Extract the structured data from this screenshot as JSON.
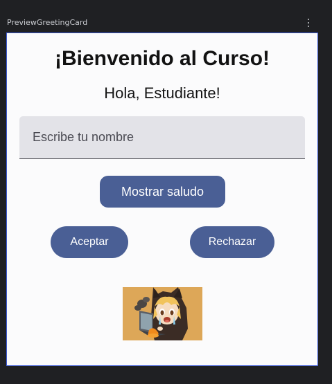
{
  "window": {
    "preview_title": "PreviewGreetingCard",
    "menu_icon": "more-vert-icon"
  },
  "card": {
    "heading": "¡Bienvenido al Curso!",
    "greeting": "Hola, Estudiante!",
    "name_input": {
      "placeholder": "Escribe tu nombre",
      "value": ""
    },
    "show_button_label": "Mostrar saludo",
    "accept_button_label": "Aceptar",
    "reject_button_label": "Rechazar",
    "image": "anime-girl-crying-at-laptop-illustration"
  },
  "colors": {
    "background": "#1f2023",
    "canvas": "#fbfbfc",
    "canvas_border": "#3d5bd6",
    "button": "#4a5f95",
    "field": "#e3e3e8"
  }
}
